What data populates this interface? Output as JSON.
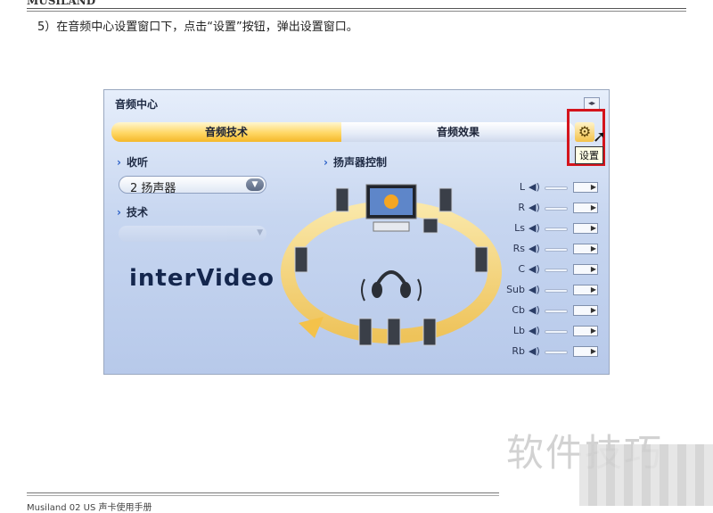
{
  "document": {
    "header_brand": "MUSILAND",
    "step_text": "5）在音频中心设置窗口下，点击“设置”按钮，弹出设置窗口。",
    "footer_text": "Musiland 02 US 声卡使用手册",
    "watermark": "软件技巧"
  },
  "window": {
    "title": "音频中心",
    "restore_icon": "restore-icon",
    "tabs": [
      {
        "label": "音频技术",
        "active": true
      },
      {
        "label": "音频效果",
        "active": false
      }
    ],
    "settings_button_icon": "gear-icon",
    "tooltip": "设置",
    "listen_label": "收听",
    "listen_value": "2 扬声器",
    "technology_label": "技术",
    "speaker_control_label": "扬声器控制",
    "logo_text": "interVideo",
    "channels": [
      "L",
      "R",
      "Ls",
      "Rs",
      "C",
      "Sub",
      "Cb",
      "Lb",
      "Rb"
    ]
  },
  "colors": {
    "highlight": "#d4141c",
    "active_tab": "#ffd764",
    "window_bg": "#c7d6f0"
  }
}
